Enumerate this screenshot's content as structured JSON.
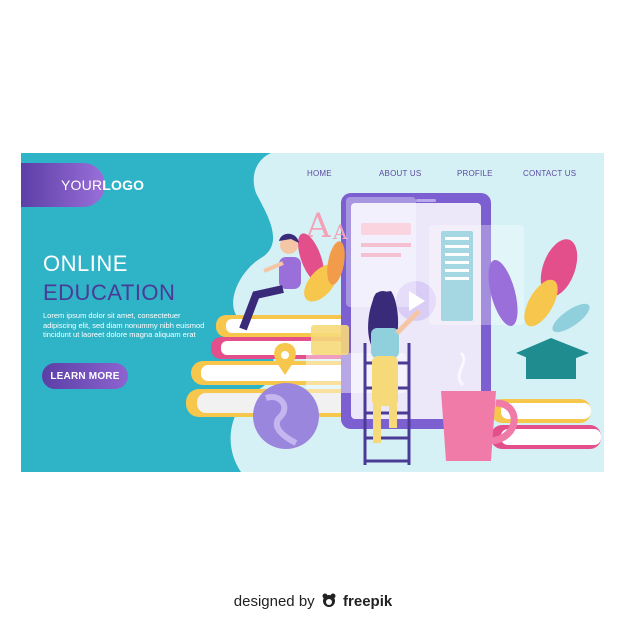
{
  "logo": {
    "text_light": "YOUR",
    "text_bold": "LOGO"
  },
  "nav": {
    "items": [
      "HOME",
      "ABOUT US",
      "PROFILE",
      "CONTACT US"
    ]
  },
  "hero": {
    "title_line1": "ONLINE",
    "title_line2": "EDUCATION",
    "body": "Lorem ipsum dolor sit amet, consectetuer adipiscing elit, sed diam nonummy nibh euismod tincidunt ut laoreet dolore magna aliquam erat",
    "cta_label": "LEARN MORE"
  },
  "illustration": {
    "tablet_letter": "A",
    "tablet_letter_small": "A"
  },
  "credit": {
    "prefix": "designed by",
    "brand": "freepik"
  },
  "colors": {
    "teal": "#2fb3c6",
    "purple": "#5b3fa6",
    "light_blob": "#d6f1f6",
    "pink": "#e24f8a"
  }
}
